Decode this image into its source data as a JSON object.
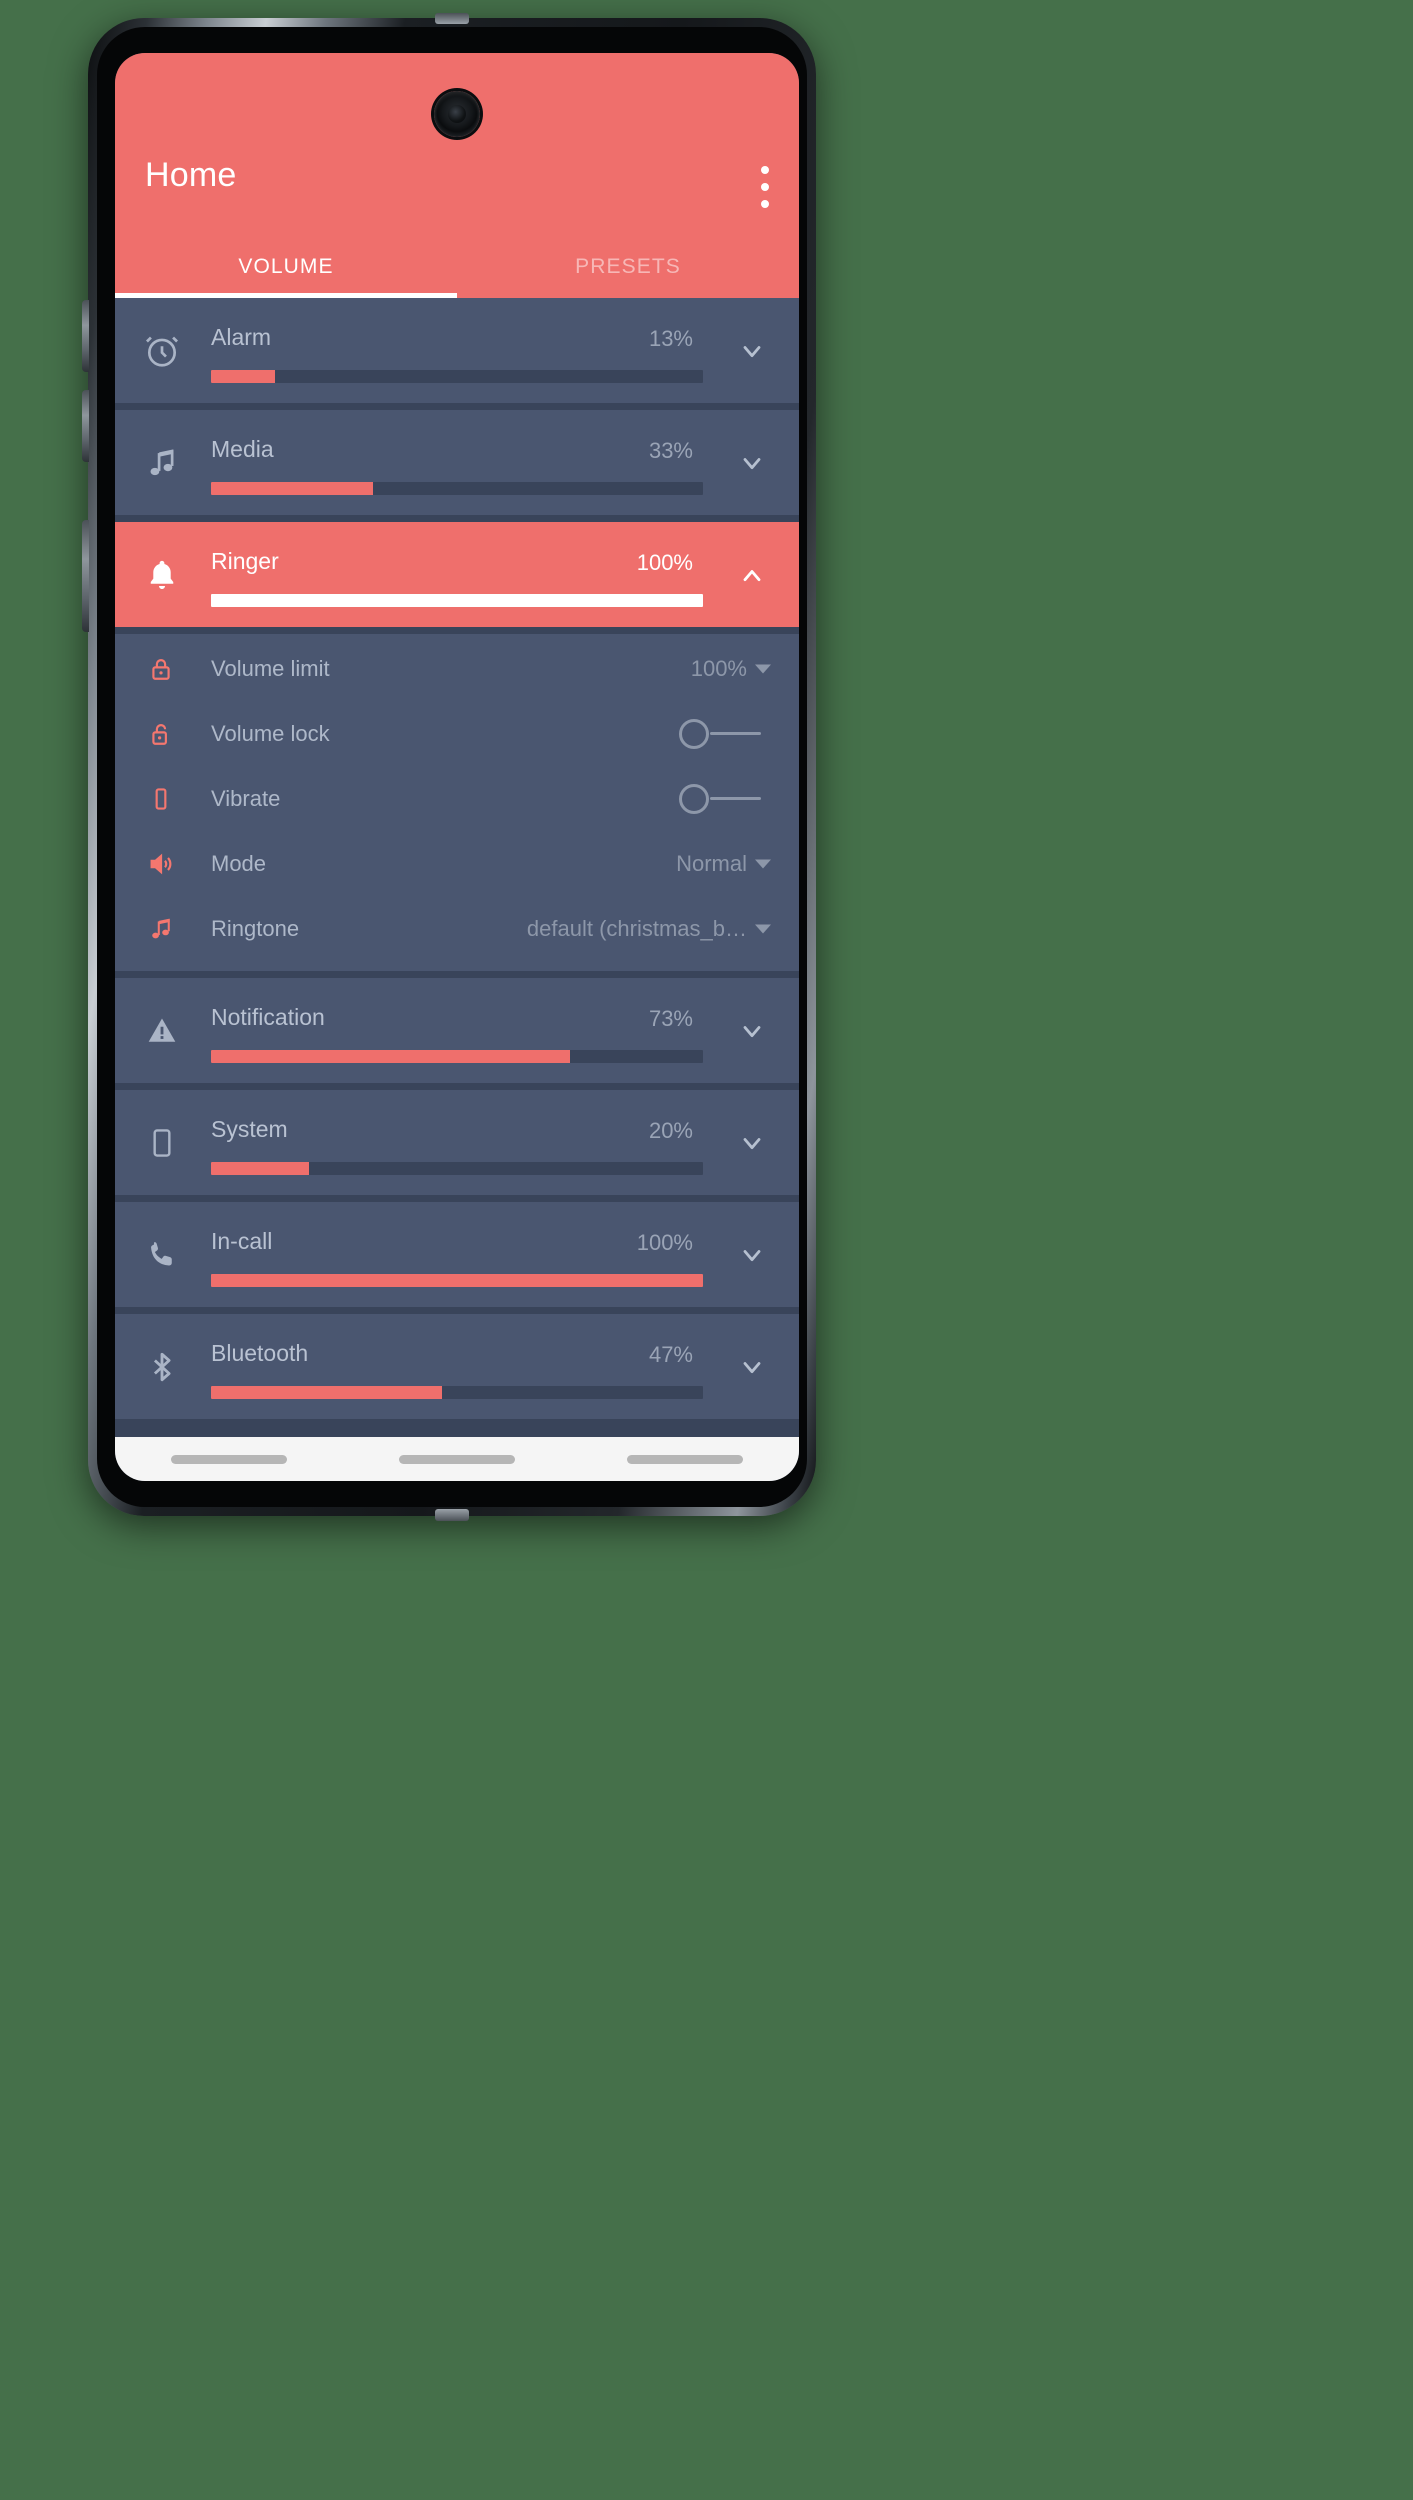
{
  "app": {
    "title": "Home",
    "overflow_menu": "more-options"
  },
  "tabs": [
    {
      "label": "VOLUME",
      "active": true
    },
    {
      "label": "PRESETS",
      "active": false
    }
  ],
  "colors": {
    "accent": "#ef6f6c",
    "surface": "#4a5670",
    "background": "#39445a",
    "text_primary": "#b9c2d2",
    "text_secondary": "#8d97a9",
    "on_accent": "#ffffff"
  },
  "streams": [
    {
      "name": "Alarm",
      "icon": "alarm-icon",
      "percent_label": "13%",
      "percent": 13,
      "expanded": false,
      "selected": false
    },
    {
      "name": "Media",
      "icon": "music-note-icon",
      "percent_label": "33%",
      "percent": 33,
      "expanded": false,
      "selected": false
    },
    {
      "name": "Ringer",
      "icon": "bell-icon",
      "percent_label": "100%",
      "percent": 100,
      "expanded": true,
      "selected": true
    },
    {
      "name": "Notification",
      "icon": "warning-icon",
      "percent_label": "73%",
      "percent": 73,
      "expanded": false,
      "selected": false
    },
    {
      "name": "System",
      "icon": "phone-device-icon",
      "percent_label": "20%",
      "percent": 20,
      "expanded": false,
      "selected": false
    },
    {
      "name": "In-call",
      "icon": "call-icon",
      "percent_label": "100%",
      "percent": 100,
      "expanded": false,
      "selected": false
    },
    {
      "name": "Bluetooth",
      "icon": "bluetooth-icon",
      "percent_label": "47%",
      "percent": 47,
      "expanded": false,
      "selected": false
    }
  ],
  "ringer_settings": [
    {
      "label": "Volume limit",
      "icon": "lock-closed-icon",
      "control": "dropdown",
      "value": "100%"
    },
    {
      "label": "Volume lock",
      "icon": "lock-open-icon",
      "control": "toggle",
      "value": "off"
    },
    {
      "label": "Vibrate",
      "icon": "vibrate-icon",
      "control": "toggle",
      "value": "off"
    },
    {
      "label": "Mode",
      "icon": "speaker-icon",
      "control": "dropdown",
      "value": "Normal"
    },
    {
      "label": "Ringtone",
      "icon": "music-note-icon",
      "control": "dropdown",
      "value": "default (christmas_b…"
    }
  ],
  "navbar": {
    "recents": "recents-pill",
    "home": "home-pill",
    "back": "back-pill"
  }
}
